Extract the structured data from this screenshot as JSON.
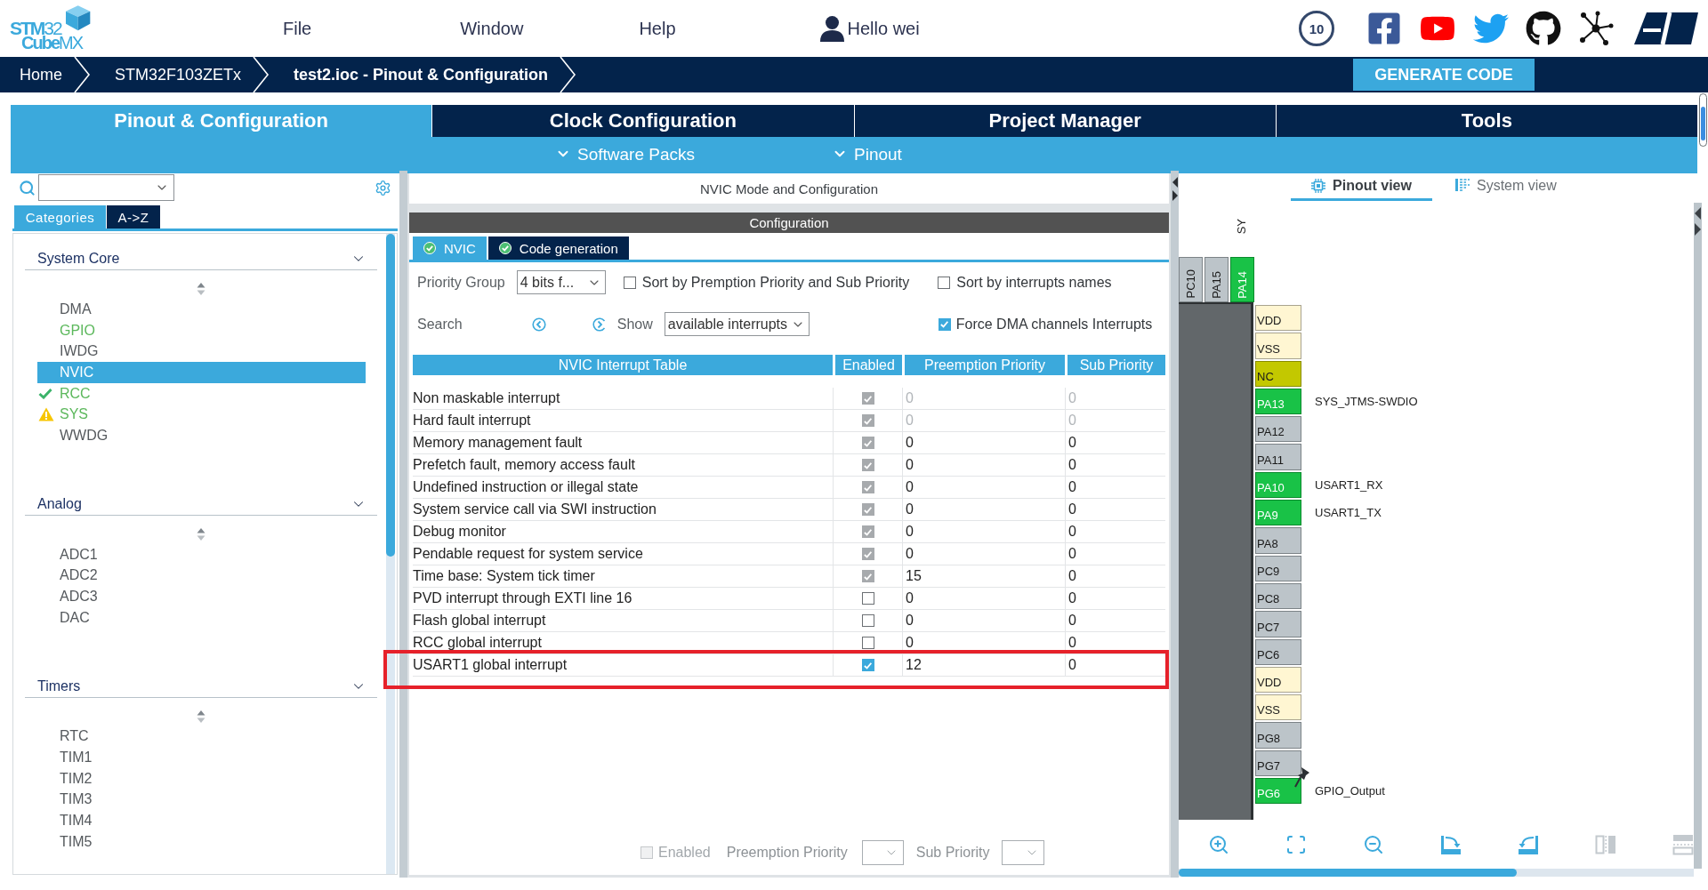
{
  "header": {
    "logo": {
      "line_1": "**STM**32",
      "line_2": "**Cube**MX"
    },
    "menu": [
      "File",
      "Window",
      "Help"
    ],
    "user": "Hello wei",
    "anniversary_badge": "10"
  },
  "breadcrumb": [
    {
      "label": "Home",
      "current": false
    },
    {
      "label": "STM32F103ZETx",
      "current": false
    },
    {
      "label": "test2.ioc - Pinout & Configuration",
      "current": true
    }
  ],
  "generate_button": "GENERATE CODE",
  "main_tabs": [
    {
      "label": "Pinout & Configuration",
      "selected": true
    },
    {
      "label": "Clock Configuration",
      "selected": false
    },
    {
      "label": "Project Manager",
      "selected": false
    },
    {
      "label": "Tools",
      "selected": false
    }
  ],
  "sub_menu": [
    "Software Packs",
    "Pinout"
  ],
  "left_panel": {
    "view_tabs": [
      {
        "label": "Categories",
        "selected": true
      },
      {
        "label": "A->Z",
        "selected": false
      }
    ],
    "categories": [
      {
        "title": "System Core",
        "items": [
          {
            "label": "DMA",
            "configured": false,
            "tick": false,
            "warning": false,
            "selected": false
          },
          {
            "label": "GPIO",
            "configured": true,
            "tick": false,
            "warning": false,
            "selected": false
          },
          {
            "label": "IWDG",
            "configured": false,
            "tick": false,
            "warning": false,
            "selected": false
          },
          {
            "label": "NVIC",
            "tick": false,
            "warning": false,
            "selected": true
          },
          {
            "label": "RCC",
            "configured": true,
            "tick": true,
            "warning": false,
            "selected": false
          },
          {
            "label": "SYS",
            "configured": true,
            "tick": false,
            "warning": true,
            "selected": false
          },
          {
            "label": "WWDG",
            "configured": false,
            "tick": false,
            "warning": false,
            "selected": false
          }
        ]
      },
      {
        "title": "Analog",
        "items": [
          {
            "label": "ADC1",
            "configured": false,
            "tick": false,
            "warning": false,
            "selected": false
          },
          {
            "label": "ADC2",
            "configured": false,
            "tick": false,
            "warning": false,
            "selected": false
          },
          {
            "label": "ADC3",
            "configured": false,
            "tick": false,
            "warning": false,
            "selected": false
          },
          {
            "label": "DAC",
            "configured": false,
            "tick": false,
            "warning": false,
            "selected": false
          }
        ]
      },
      {
        "title": "Timers",
        "items": [
          {
            "label": "RTC",
            "configured": false,
            "tick": false,
            "warning": false,
            "selected": false
          },
          {
            "label": "TIM1",
            "configured": false,
            "tick": false,
            "warning": false,
            "selected": false
          },
          {
            "label": "TIM2",
            "configured": false,
            "tick": false,
            "warning": false,
            "selected": false
          },
          {
            "label": "TIM3",
            "configured": false,
            "tick": false,
            "warning": false,
            "selected": false
          },
          {
            "label": "TIM4",
            "configured": false,
            "tick": false,
            "warning": false,
            "selected": false
          },
          {
            "label": "TIM5",
            "configured": false,
            "tick": false,
            "warning": false,
            "selected": false
          }
        ]
      }
    ]
  },
  "nvic_panel": {
    "title": "NVIC Mode and Configuration",
    "section": "Configuration",
    "tabs": [
      {
        "label": "NVIC",
        "selected": true
      },
      {
        "label": "Code generation",
        "selected": false
      }
    ],
    "priority_group": {
      "label": "Priority Group",
      "value": "4 bits f..."
    },
    "sort_options": [
      {
        "label": "Sort by Premption Priority and Sub Priority",
        "checked": false
      },
      {
        "label": "Sort by interrupts names",
        "checked": false
      }
    ],
    "search_label": "Search",
    "show": {
      "label": "Show",
      "value": "available interrupts"
    },
    "force_dma": {
      "label": "Force DMA channels Interrupts",
      "checked": true
    },
    "table": {
      "columns": [
        "NVIC Interrupt Table",
        "Enabled",
        "Preemption Priority",
        "Sub Priority"
      ],
      "rows": [
        {
          "name": "Non maskable interrupt",
          "enabled": true,
          "checkbox_disabled": true,
          "preemption": "0",
          "sub": "0",
          "priority_disabled": true,
          "highlighted": false
        },
        {
          "name": "Hard fault interrupt",
          "enabled": true,
          "checkbox_disabled": true,
          "preemption": "0",
          "sub": "0",
          "priority_disabled": true,
          "highlighted": false
        },
        {
          "name": "Memory management fault",
          "enabled": true,
          "checkbox_disabled": true,
          "preemption": "0",
          "sub": "0",
          "priority_disabled": false,
          "highlighted": false
        },
        {
          "name": "Prefetch fault, memory access fault",
          "enabled": true,
          "checkbox_disabled": true,
          "preemption": "0",
          "sub": "0",
          "priority_disabled": false,
          "highlighted": false
        },
        {
          "name": "Undefined instruction or illegal state",
          "enabled": true,
          "checkbox_disabled": true,
          "preemption": "0",
          "sub": "0",
          "priority_disabled": false,
          "highlighted": false
        },
        {
          "name": "System service call via SWI instruction",
          "enabled": true,
          "checkbox_disabled": true,
          "preemption": "0",
          "sub": "0",
          "priority_disabled": false,
          "highlighted": false
        },
        {
          "name": "Debug monitor",
          "enabled": true,
          "checkbox_disabled": true,
          "preemption": "0",
          "sub": "0",
          "priority_disabled": false,
          "highlighted": false
        },
        {
          "name": "Pendable request for system service",
          "enabled": true,
          "checkbox_disabled": true,
          "preemption": "0",
          "sub": "0",
          "priority_disabled": false,
          "highlighted": false
        },
        {
          "name": "Time base: System tick timer",
          "enabled": true,
          "checkbox_disabled": true,
          "preemption": "15",
          "sub": "0",
          "priority_disabled": false,
          "highlighted": false
        },
        {
          "name": "PVD interrupt through EXTI line 16",
          "enabled": false,
          "checkbox_disabled": false,
          "preemption": "0",
          "sub": "0",
          "priority_disabled": false,
          "highlighted": false
        },
        {
          "name": "Flash global interrupt",
          "enabled": false,
          "checkbox_disabled": false,
          "preemption": "0",
          "sub": "0",
          "priority_disabled": false,
          "highlighted": false
        },
        {
          "name": "RCC global interrupt",
          "enabled": false,
          "checkbox_disabled": false,
          "preemption": "0",
          "sub": "0",
          "priority_disabled": false,
          "highlighted": false
        },
        {
          "name": "USART1 global interrupt",
          "enabled": true,
          "checkbox_disabled": false,
          "preemption": "12",
          "sub": "0",
          "priority_disabled": false,
          "highlighted": true
        }
      ]
    },
    "footer": {
      "enabled": {
        "label": "Enabled",
        "checked": false,
        "disabled": true
      },
      "preemption_label": "Preemption Priority",
      "sub_label": "Sub Priority"
    }
  },
  "pinout_panel": {
    "tabs": [
      {
        "label": "Pinout view",
        "selected": true
      },
      {
        "label": "System view",
        "selected": false
      }
    ],
    "top_pins": [
      {
        "label": "PC10",
        "kind": "free"
      },
      {
        "label": "PA15",
        "kind": "free"
      },
      {
        "label": "PA14",
        "kind": "assigned",
        "signal": "SY"
      }
    ],
    "right_pins": [
      {
        "label": "VDD",
        "kind": "power",
        "pinned": false
      },
      {
        "label": "VSS",
        "kind": "power",
        "pinned": false
      },
      {
        "label": "NC",
        "kind": "nc",
        "pinned": false
      },
      {
        "label": "PA13",
        "kind": "assigned",
        "signal": "SYS_JTMS-SWDIO",
        "pinned": false
      },
      {
        "label": "PA12",
        "kind": "free",
        "pinned": false
      },
      {
        "label": "PA11",
        "kind": "free",
        "pinned": false
      },
      {
        "label": "PA10",
        "kind": "assigned",
        "signal": "USART1_RX",
        "pinned": false
      },
      {
        "label": "PA9",
        "kind": "assigned",
        "signal": "USART1_TX",
        "pinned": false
      },
      {
        "label": "PA8",
        "kind": "free",
        "pinned": false
      },
      {
        "label": "PC9",
        "kind": "free",
        "pinned": false
      },
      {
        "label": "PC8",
        "kind": "free",
        "pinned": false
      },
      {
        "label": "PC7",
        "kind": "free",
        "pinned": false
      },
      {
        "label": "PC6",
        "kind": "free",
        "pinned": false
      },
      {
        "label": "VDD",
        "kind": "power",
        "pinned": false
      },
      {
        "label": "VSS",
        "kind": "power",
        "pinned": false
      },
      {
        "label": "PG8",
        "kind": "free",
        "pinned": false
      },
      {
        "label": "PG7",
        "kind": "free",
        "pinned": false
      },
      {
        "label": "PG6",
        "kind": "assigned",
        "signal": "GPIO_Output",
        "pinned": true
      }
    ],
    "toolbar": [
      {
        "kind": "zoom_in",
        "disabled": false
      },
      {
        "kind": "fit",
        "disabled": false
      },
      {
        "kind": "zoom_out",
        "disabled": false
      },
      {
        "kind": "rotate_right",
        "disabled": false
      },
      {
        "kind": "rotate_left",
        "disabled": false
      },
      {
        "kind": "columns",
        "disabled": true
      },
      {
        "kind": "rows",
        "disabled": true
      }
    ]
  }
}
